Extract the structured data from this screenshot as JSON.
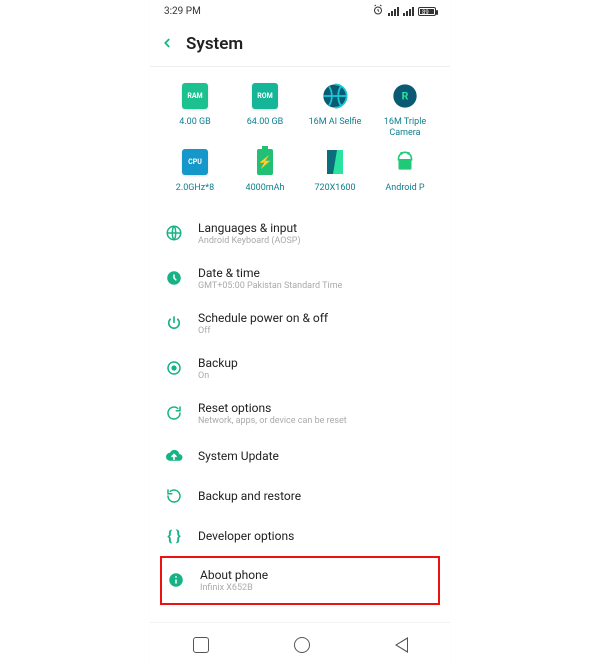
{
  "status": {
    "time": "3:29 PM",
    "battery_pct": "89"
  },
  "header": {
    "title": "System"
  },
  "specs": [
    {
      "icon": "ram",
      "label": "4.00 GB"
    },
    {
      "icon": "rom",
      "label": "64.00 GB"
    },
    {
      "icon": "aperture",
      "label": "16M AI Selfie"
    },
    {
      "icon": "aperture",
      "label": "16M Triple Camera"
    },
    {
      "icon": "cpu",
      "label": "2.0GHz*8"
    },
    {
      "icon": "battery",
      "label": "4000mAh"
    },
    {
      "icon": "screen",
      "label": "720X1600"
    },
    {
      "icon": "android",
      "label": "Android P"
    }
  ],
  "items": [
    {
      "icon": "globe",
      "title": "Languages & input",
      "sub": "Android Keyboard (AOSP)"
    },
    {
      "icon": "clock",
      "title": "Date & time",
      "sub": "GMT+05:00 Pakistan Standard Time"
    },
    {
      "icon": "power",
      "title": "Schedule power on & off",
      "sub": "Off"
    },
    {
      "icon": "target",
      "title": "Backup",
      "sub": "On"
    },
    {
      "icon": "refresh",
      "title": "Reset options",
      "sub": "Network, apps, or device can be reset"
    },
    {
      "icon": "cloud-up",
      "title": "System Update",
      "sub": ""
    },
    {
      "icon": "restore",
      "title": "Backup and restore",
      "sub": ""
    },
    {
      "icon": "braces",
      "title": "Developer options",
      "sub": ""
    },
    {
      "icon": "info",
      "title": "About phone",
      "sub": "Infinix X652B",
      "highlight": true
    }
  ]
}
